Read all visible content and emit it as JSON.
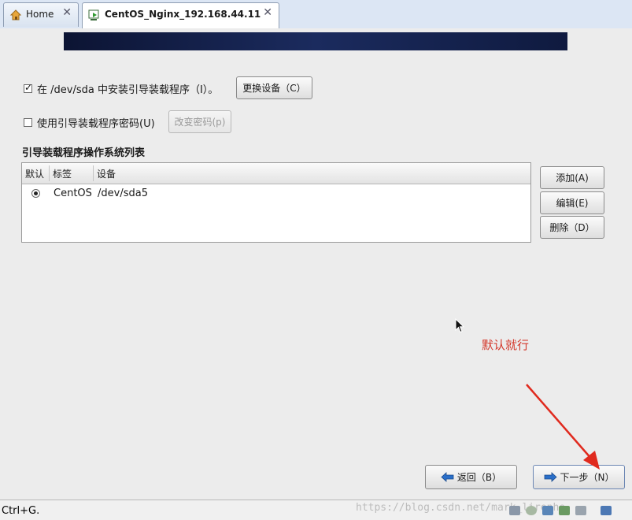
{
  "tabs": [
    {
      "label": "Home",
      "icon": "home-icon",
      "close": "✕",
      "active": false
    },
    {
      "label": "CentOS_Nginx_192.168.44.11",
      "icon": "vm-icon",
      "close": "✕",
      "active": true
    }
  ],
  "bootloader": {
    "install_checkbox_checked": true,
    "install_label": "在 /dev/sda 中安装引导装载程序（I）。",
    "change_device_button": "更换设备（C）",
    "password_checkbox_checked": false,
    "password_label": "使用引导装载程序密码(U)",
    "change_password_button": "改变密码(p)"
  },
  "os_list": {
    "title": "引导装载程序操作系统列表",
    "columns": [
      "默认",
      "标签",
      "设备"
    ],
    "rows": [
      {
        "default": true,
        "label": "CentOS",
        "device": "/dev/sda5"
      }
    ]
  },
  "side_buttons": {
    "add": "添加(A)",
    "edit": "编辑(E)",
    "delete": "删除（D）"
  },
  "annotation": "默认就行",
  "nav": {
    "back": "返回（B）",
    "next": "下一步（N）"
  },
  "statusbar": {
    "text": "Ctrl+G.",
    "watermark": "https://blog.csdn.net/mark_lirenhe"
  },
  "colors": {
    "annotation": "#d4382c",
    "banner": "#1b2b5e",
    "nav_arrow": "#2a6fc9"
  }
}
